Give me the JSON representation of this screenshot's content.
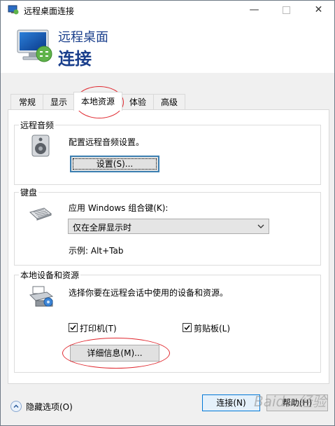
{
  "window": {
    "title": "远程桌面连接",
    "controls": {
      "minimize": "—",
      "close": "✕"
    }
  },
  "header": {
    "line1": "远程桌面",
    "line2": "连接"
  },
  "tabs": [
    {
      "label": "常规"
    },
    {
      "label": "显示"
    },
    {
      "label": "本地资源",
      "active": true
    },
    {
      "label": "体验"
    },
    {
      "label": "高级"
    }
  ],
  "audio": {
    "group_label": "远程音频",
    "description": "配置远程音频设置。",
    "settings_button": "设置(S)..."
  },
  "keyboard": {
    "group_label": "键盘",
    "description": "应用 Windows 组合键(K):",
    "selected_option": "仅在全屏显示时",
    "example": "示例: Alt+Tab"
  },
  "devices": {
    "group_label": "本地设备和资源",
    "description": "选择你要在远程会话中使用的设备和资源。",
    "printer_label": "打印机(T)",
    "printer_checked": true,
    "clipboard_label": "剪贴板(L)",
    "clipboard_checked": true,
    "more_button": "详细信息(M)..."
  },
  "footer": {
    "hide_options": "隐藏选项(O)",
    "connect_button": "连接(N)",
    "help_button": "帮助(H)"
  },
  "watermark": "Baidu 经验",
  "colors": {
    "header_text": "#1a3f8c",
    "annotation": "#e0282f",
    "accent": "#0078d7"
  }
}
